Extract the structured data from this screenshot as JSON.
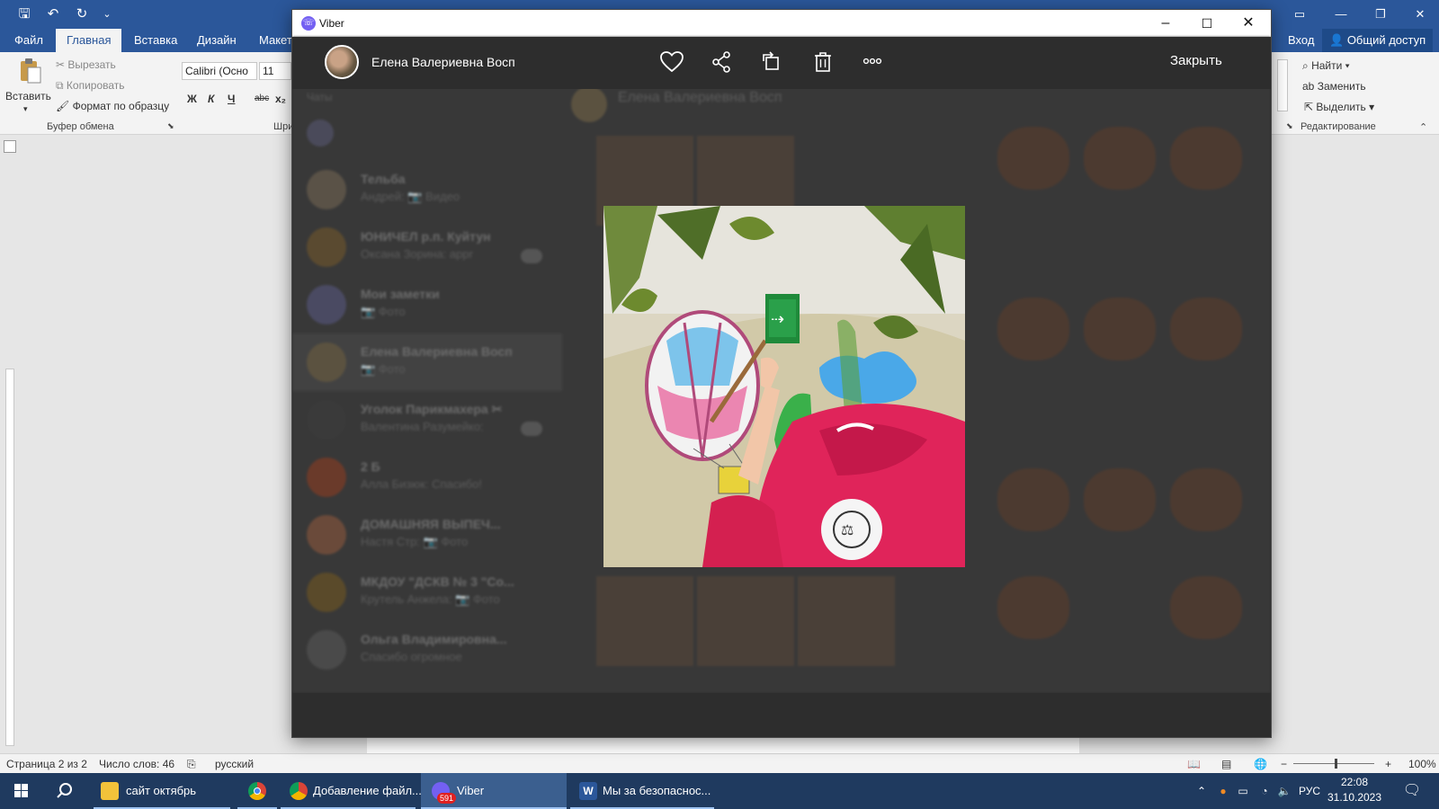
{
  "word": {
    "tabs": [
      "Файл",
      "Главная",
      "Вставка",
      "Дизайн",
      "Макет"
    ],
    "active_tab": "Главная",
    "sign_in": "Вход",
    "share": "Общий доступ",
    "clipboard": {
      "paste": "Вставить",
      "cut": "Вырезать",
      "copy": "Копировать",
      "format_painter": "Формат по образцу",
      "group": "Буфер обмена"
    },
    "font": {
      "name": "Calibri (Осно",
      "size": "11",
      "bold": "Ж",
      "italic": "К",
      "underline": "Ч",
      "strike": "abc",
      "subscript": "x₂",
      "group": "Шри"
    },
    "editing": {
      "find": "Найти",
      "replace": "Заменить",
      "select": "Выделить",
      "group": "Редактирование"
    },
    "status": {
      "page": "Страница 2 из 2",
      "words": "Число слов: 46",
      "language": "русский",
      "zoom": "100%"
    }
  },
  "viber": {
    "window_title": "Viber",
    "contact_name": "Елена Валериевна Восп",
    "close_label": "Закрыть",
    "background_chats": [
      {
        "name": "Тельба",
        "preview": "Андрей: 📷 Видео",
        "time": "",
        "badge": ""
      },
      {
        "name": "ЮНИЧЕЛ р.п. Куйтун",
        "preview": "Оксана Зорина: appr",
        "time": "",
        "badge": ""
      },
      {
        "name": "Мои заметки",
        "preview": "📷 Фото",
        "time": "",
        "badge": ""
      },
      {
        "name": "Елена Валериевна Восп",
        "preview": "📷 Фото",
        "time": "",
        "badge": ""
      },
      {
        "name": "Уголок Парикмахера ✂",
        "preview": "Валентина Разумейко:",
        "time": "",
        "badge": ""
      },
      {
        "name": "2 Б",
        "preview": "Алла Бизюк: Спасибо!",
        "time": "",
        "badge": ""
      },
      {
        "name": "ДОМАШНЯЯ ВЫПЕЧ...",
        "preview": "Настя Стр: 📷 Фото",
        "time": "",
        "badge": ""
      },
      {
        "name": "МКДОУ \"ДСКВ № 3 \"Со...",
        "preview": "Крутель Анжела: 📷 Фото",
        "time": "",
        "badge": ""
      },
      {
        "name": "Ольга Владимировна...",
        "preview": "Спасибо огромное",
        "time": "",
        "badge": ""
      }
    ],
    "conv_header": "Елена Валериевна Восп"
  },
  "taskbar": {
    "apps": [
      {
        "label": "сайт октябрь",
        "active": false
      },
      {
        "label": "",
        "active": false
      },
      {
        "label": "Добавление файл...",
        "active": false
      },
      {
        "label": "Viber",
        "active": true
      },
      {
        "label": "Мы за безопаснос...",
        "active": false
      }
    ],
    "viber_badge": "591",
    "language": "РУС",
    "time": "22:08",
    "date": "31.10.2023"
  },
  "colors": {
    "word_blue": "#2b579a",
    "viber_purple": "#7360f2",
    "viewer_bg": "#2d2d2d"
  }
}
